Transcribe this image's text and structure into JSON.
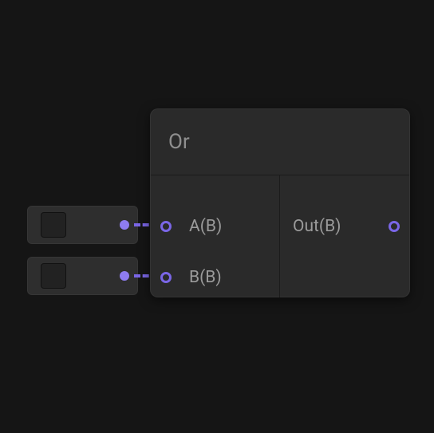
{
  "node": {
    "title": "Or",
    "inputs": [
      {
        "label": "A(B)"
      },
      {
        "label": "B(B)"
      }
    ],
    "outputs": [
      {
        "label": "Out(B)"
      }
    ]
  }
}
